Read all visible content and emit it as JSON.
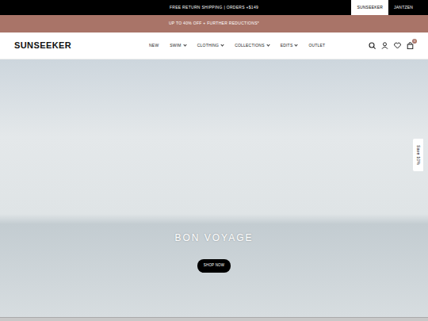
{
  "announcement": "FREE RETURN SHIPPING | ORDERS +$149",
  "brands": [
    {
      "label": "SUNSEEKER",
      "selected": true
    },
    {
      "label": "JANTZEN",
      "selected": false
    }
  ],
  "promo": "UP TO 40% OFF + FURTHER REDUCTIONS*",
  "logo": "SUNSEEKER",
  "nav": [
    {
      "label": "NEW",
      "dropdown": false
    },
    {
      "label": "SWIM",
      "dropdown": true
    },
    {
      "label": "CLOTHING",
      "dropdown": true
    },
    {
      "label": "COLLECTIONS",
      "dropdown": true
    },
    {
      "label": "EDITS",
      "dropdown": true
    },
    {
      "label": "OUTLET",
      "dropdown": false
    }
  ],
  "cart_count": "0",
  "hero": {
    "title": "BON VOYAGE",
    "button": "SHOP NOW"
  },
  "side_tab": "Save 10%"
}
